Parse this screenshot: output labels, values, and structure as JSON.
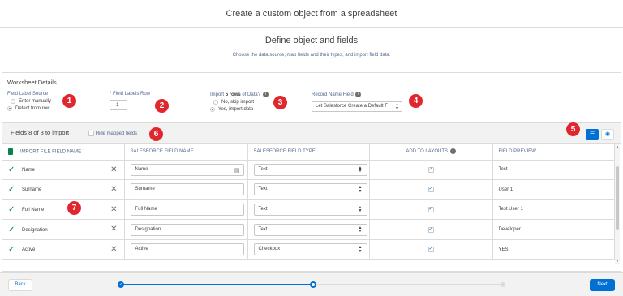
{
  "header": {
    "title": "Create a custom object from a spreadsheet"
  },
  "intro": {
    "title": "Define object and fields",
    "subtitle": "Choose the data source, map fields and their types, and import field data."
  },
  "worksheet": {
    "title": "Worksheet Details",
    "field_label_source": {
      "label": "Field Label Source",
      "options": [
        "Enter manually",
        "Detect from row"
      ],
      "selected": "Detect from row"
    },
    "field_labels_row": {
      "required_mark": "*",
      "label": "Field Labels Row",
      "value": "1"
    },
    "import_rows": {
      "label_prefix": "Import",
      "label_bold": "5 rows",
      "label_suffix": "of Data?",
      "options": [
        "No, skip import",
        "Yes, import data"
      ],
      "selected": "Yes, import data"
    },
    "record_name_field": {
      "label": "Record Name Field",
      "value": "Let Salesforce Create a Default F"
    }
  },
  "callouts": [
    "1",
    "2",
    "3",
    "4",
    "5",
    "6",
    "7"
  ],
  "toolbar": {
    "fields_count": "Fields 8 of 8 to import",
    "hide_mapped": "Hide mapped fields"
  },
  "table": {
    "headers": [
      "IMPORT FILE FIELD NAME",
      "SALESFORCE FIELD NAME",
      "SALESFORCE FIELD TYPE",
      "ADD TO LAYOUTS",
      "FIELD PREVIEW"
    ],
    "rows": [
      {
        "import_name": "Name",
        "sf_name": "Name",
        "sf_type": "Text",
        "add": true,
        "preview": "Test"
      },
      {
        "import_name": "Surname",
        "sf_name": "Surname",
        "sf_type": "Text",
        "add": true,
        "preview": "User 1"
      },
      {
        "import_name": "Full Name",
        "sf_name": "Full Name",
        "sf_type": "Text",
        "add": true,
        "preview": "Test User 1"
      },
      {
        "import_name": "Designation",
        "sf_name": "Designation",
        "sf_type": "Text",
        "add": true,
        "preview": "Developer"
      },
      {
        "import_name": "Active",
        "sf_name": "Active",
        "sf_type": "Checkbox",
        "add": true,
        "preview": "YES"
      }
    ]
  },
  "footer": {
    "back": "Back",
    "next": "Next"
  },
  "colors": {
    "brand": "#0070d2",
    "callout": "#e0272e",
    "success": "#04844b"
  },
  "icons": [
    "info-icon",
    "spreadsheet-icon",
    "checkmark-icon",
    "remove-icon",
    "list-view-icon",
    "preview-eye-icon",
    "picklist-icon"
  ]
}
